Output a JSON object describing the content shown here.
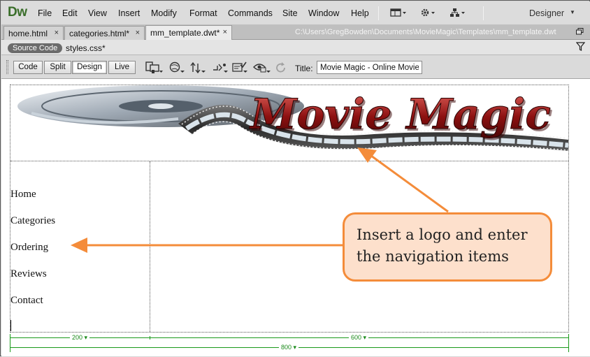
{
  "app": {
    "logo": "Dw",
    "workspace": "Designer"
  },
  "menu": [
    "File",
    "Edit",
    "View",
    "Insert",
    "Modify",
    "Format",
    "Commands",
    "Site",
    "Window",
    "Help"
  ],
  "toolbar_icons": [
    "layout-icon",
    "settings-gear-icon",
    "site-structure-icon"
  ],
  "tabs": [
    {
      "label": "home.html",
      "active": false
    },
    {
      "label": "categories.html*",
      "active": false
    },
    {
      "label": "mm_template.dwt*",
      "active": true
    }
  ],
  "tab_close_glyph": "×",
  "file_path": "C:\\Users\\GregBowden\\Documents\\MovieMagic\\Templates\\mm_template.dwt",
  "related_files": {
    "source_code": "Source Code",
    "file": "styles.css*"
  },
  "view_buttons": [
    {
      "label": "Code",
      "active": false
    },
    {
      "label": "Split",
      "active": false
    },
    {
      "label": "Design",
      "active": true
    },
    {
      "label": "Live",
      "active": false
    }
  ],
  "document_title": {
    "label": "Title:",
    "value": "Movie Magic - Online Movies"
  },
  "design": {
    "logo_text": "Movie Magic",
    "nav_items": [
      "Home",
      "Categories",
      "Ordering",
      "Reviews",
      "Contact"
    ],
    "width_labels": {
      "left": "200",
      "right": "600",
      "total": "800"
    }
  },
  "callout": {
    "line1": "Insert a logo and enter",
    "line2": "the navigation items"
  },
  "colors": {
    "accent": "#f48c3a",
    "callout_fill": "#fde0cc",
    "width_guide": "#1a9a1a",
    "logo_red": "#8c1010"
  }
}
